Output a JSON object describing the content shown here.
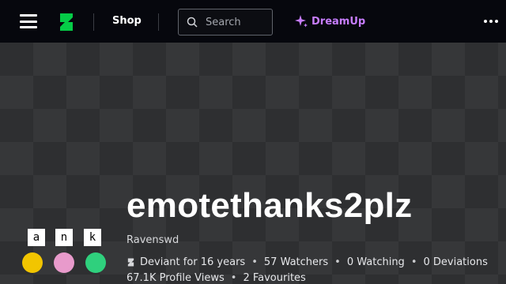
{
  "header": {
    "nav": {
      "shop_label": "Shop",
      "dreamup_label": "DreamUp"
    },
    "search": {
      "placeholder": "Search"
    },
    "icons": [
      "menu-icon",
      "deviantart-logo-icon",
      "search-icon",
      "sparkle-icon",
      "more-dots-icon"
    ],
    "colors": {
      "bar": "#06070d",
      "logo": "#05cc47",
      "dreamup": "#c77dff"
    }
  },
  "profile": {
    "username": "emotethanks2plz",
    "realname": "Ravenswd",
    "deviant_for": "Deviant for 16 years",
    "watchers": "57 Watchers",
    "watching": "0 Watching",
    "deviations": "0 Deviations",
    "profile_views": "67.1K Profile Views",
    "favourites": "2 Favourites",
    "avatar_letters": [
      "a",
      "n",
      "k"
    ],
    "stat_separator": "•"
  }
}
